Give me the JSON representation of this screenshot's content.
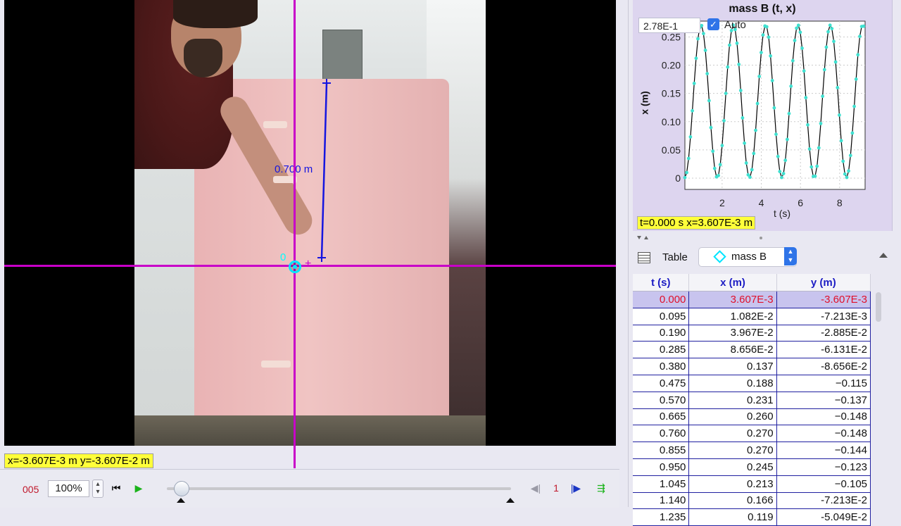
{
  "video": {
    "axis_origin_label": "0",
    "tape_length_label": "0.700 m",
    "coord_readout": "x=-3.607E-3 m  y=-3.607E-2 m"
  },
  "player": {
    "frame": "005",
    "zoom": "100%",
    "step_size": "1",
    "slider_value_fraction": 0.04
  },
  "plot": {
    "title": "mass B (t, x)",
    "scale_value": "2.78E-1",
    "auto_label": "Auto",
    "auto_checked": true,
    "ylabel": "x (m)",
    "xlabel": "t (s)",
    "readout": "t=0.000 s  x=3.607E-3 m"
  },
  "table_panel": {
    "label": "Table",
    "track_name": "mass B",
    "columns": [
      "t (s)",
      "x (m)",
      "y (m)"
    ],
    "rows": [
      [
        "0.000",
        "3.607E-3",
        "-3.607E-3"
      ],
      [
        "0.095",
        "1.082E-2",
        "-7.213E-3"
      ],
      [
        "0.190",
        "3.967E-2",
        "-2.885E-2"
      ],
      [
        "0.285",
        "8.656E-2",
        "-6.131E-2"
      ],
      [
        "0.380",
        "0.137",
        "-8.656E-2"
      ],
      [
        "0.475",
        "0.188",
        "−0.115"
      ],
      [
        "0.570",
        "0.231",
        "−0.137"
      ],
      [
        "0.665",
        "0.260",
        "−0.148"
      ],
      [
        "0.760",
        "0.270",
        "−0.148"
      ],
      [
        "0.855",
        "0.270",
        "−0.144"
      ],
      [
        "0.950",
        "0.245",
        "−0.123"
      ],
      [
        "1.045",
        "0.213",
        "−0.105"
      ],
      [
        "1.140",
        "0.166",
        "-7.213E-2"
      ],
      [
        "1.235",
        "0.119",
        "-5.049E-2"
      ]
    ]
  },
  "chart_data": {
    "type": "line",
    "title": "mass B (t, x)",
    "xlabel": "t (s)",
    "ylabel": "x (m)",
    "x_ticks": [
      "2",
      "4",
      "6",
      "8"
    ],
    "y_ticks": [
      "0",
      "0.05",
      "0.10",
      "0.15",
      "0.20",
      "0.25"
    ],
    "xlim": [
      0.1,
      9.3
    ],
    "ylim": [
      -0.02,
      0.278
    ],
    "series": [
      {
        "style": "line with markers",
        "amplitude": 0.135,
        "offset": 0.136,
        "period_s": 1.65,
        "sample_dt_s": 0.095
      }
    ],
    "colors": {
      "line": "#000000",
      "markers": "#3fe0d0",
      "background": "#ffffff"
    },
    "grid": true
  }
}
